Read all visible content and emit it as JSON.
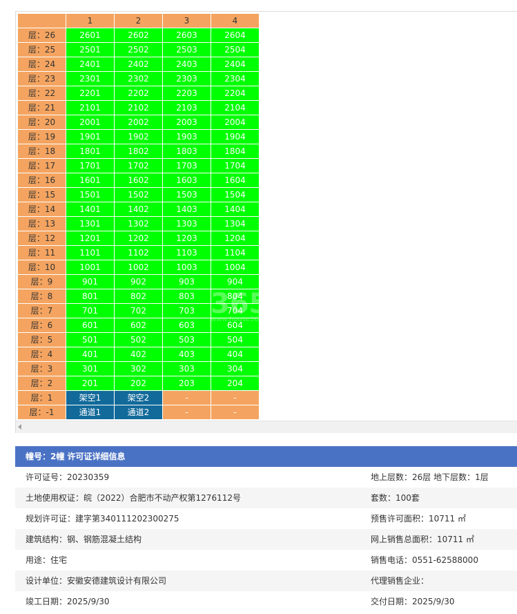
{
  "columns": [
    "1",
    "2",
    "3",
    "4"
  ],
  "floors": [
    {
      "label": "层：26",
      "units": [
        "2601",
        "2602",
        "2603",
        "2604"
      ]
    },
    {
      "label": "层：25",
      "units": [
        "2501",
        "2502",
        "2503",
        "2504"
      ]
    },
    {
      "label": "层：24",
      "units": [
        "2401",
        "2402",
        "2403",
        "2404"
      ]
    },
    {
      "label": "层：23",
      "units": [
        "2301",
        "2302",
        "2303",
        "2304"
      ]
    },
    {
      "label": "层：22",
      "units": [
        "2201",
        "2202",
        "2203",
        "2204"
      ]
    },
    {
      "label": "层：21",
      "units": [
        "2101",
        "2102",
        "2103",
        "2104"
      ]
    },
    {
      "label": "层：20",
      "units": [
        "2001",
        "2002",
        "2003",
        "2004"
      ]
    },
    {
      "label": "层：19",
      "units": [
        "1901",
        "1902",
        "1903",
        "1904"
      ]
    },
    {
      "label": "层：18",
      "units": [
        "1801",
        "1802",
        "1803",
        "1804"
      ]
    },
    {
      "label": "层：17",
      "units": [
        "1701",
        "1702",
        "1703",
        "1704"
      ]
    },
    {
      "label": "层：16",
      "units": [
        "1601",
        "1602",
        "1603",
        "1604"
      ]
    },
    {
      "label": "层：15",
      "units": [
        "1501",
        "1502",
        "1503",
        "1504"
      ]
    },
    {
      "label": "层：14",
      "units": [
        "1401",
        "1402",
        "1403",
        "1404"
      ]
    },
    {
      "label": "层：13",
      "units": [
        "1301",
        "1302",
        "1303",
        "1304"
      ]
    },
    {
      "label": "层：12",
      "units": [
        "1201",
        "1202",
        "1203",
        "1204"
      ]
    },
    {
      "label": "层：11",
      "units": [
        "1101",
        "1102",
        "1103",
        "1104"
      ]
    },
    {
      "label": "层：10",
      "units": [
        "1001",
        "1002",
        "1003",
        "1004"
      ]
    },
    {
      "label": "层：9",
      "units": [
        "901",
        "902",
        "903",
        "904"
      ]
    },
    {
      "label": "层：8",
      "units": [
        "801",
        "802",
        "803",
        "804"
      ]
    },
    {
      "label": "层：7",
      "units": [
        "701",
        "702",
        "703",
        "704"
      ]
    },
    {
      "label": "层：6",
      "units": [
        "601",
        "602",
        "603",
        "604"
      ]
    },
    {
      "label": "层：5",
      "units": [
        "501",
        "502",
        "503",
        "504"
      ]
    },
    {
      "label": "层：4",
      "units": [
        "401",
        "402",
        "403",
        "404"
      ]
    },
    {
      "label": "层：3",
      "units": [
        "301",
        "302",
        "303",
        "304"
      ]
    },
    {
      "label": "层：2",
      "units": [
        "201",
        "202",
        "203",
        "204"
      ]
    },
    {
      "label": "层：1",
      "units": [
        "架空1",
        "架空2",
        "-",
        "-"
      ]
    },
    {
      "label": "层：-1",
      "units": [
        "通道1",
        "通道2",
        "-",
        "-"
      ]
    }
  ],
  "watermark": "365",
  "watermark_sub": "www.house365.com",
  "info": {
    "header": "幢号：2幢 许可证详细信息",
    "rows": [
      {
        "left": "许可证号：20230359",
        "right": "地上层数：26层  地下层数：1层"
      },
      {
        "left": "土地使用权证：皖（2022）合肥市不动产权第1276112号",
        "right": "套数：100套"
      },
      {
        "left": "规划许可证：建字第340111202300275",
        "right": "预售许可面积：10711 ㎡"
      },
      {
        "left": "建筑结构：钢、钢筋混凝土结构",
        "right": "网上销售总面积：10711 ㎡"
      },
      {
        "left": "用途：住宅",
        "right": "销售电话：0551-62588000"
      },
      {
        "left": "设计单位：安徽安德建筑设计有限公司",
        "right": "代理销售企业："
      },
      {
        "left": "竣工日期：2025/9/30",
        "right": "交付日期：2025/9/30"
      }
    ]
  },
  "colors": {
    "available": "#00ff00",
    "label": "#f4a460",
    "special": "#126a9a",
    "header": "#4a72c4"
  }
}
